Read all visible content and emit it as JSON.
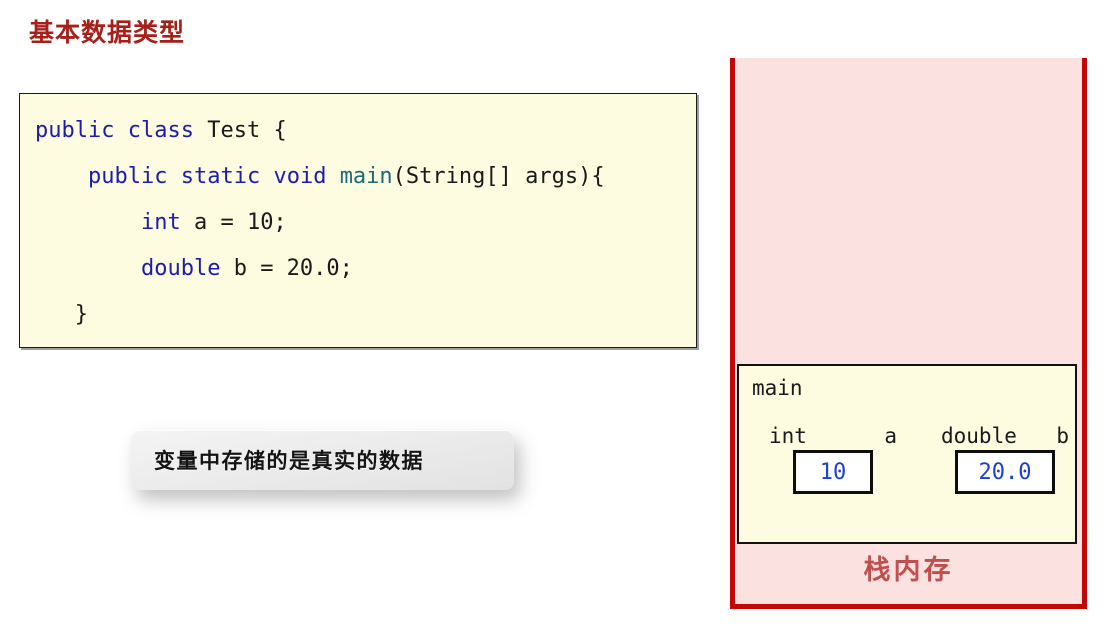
{
  "page": {
    "title": "基本数据类型"
  },
  "code_block": {
    "language": "java",
    "lines": [
      [
        {
          "t": "public",
          "c": "kw"
        },
        {
          "t": " ",
          "c": "plain"
        },
        {
          "t": "class",
          "c": "kw"
        },
        {
          "t": " Test {",
          "c": "plain"
        }
      ],
      [
        {
          "t": "    ",
          "c": "plain"
        },
        {
          "t": "public",
          "c": "kw"
        },
        {
          "t": " ",
          "c": "plain"
        },
        {
          "t": "static",
          "c": "kw"
        },
        {
          "t": " ",
          "c": "plain"
        },
        {
          "t": "void",
          "c": "kw"
        },
        {
          "t": " ",
          "c": "plain"
        },
        {
          "t": "main",
          "c": "fn"
        },
        {
          "t": "(String[] args){",
          "c": "plain"
        }
      ],
      [
        {
          "t": "        ",
          "c": "plain"
        },
        {
          "t": "int",
          "c": "kw"
        },
        {
          "t": " a = 10;",
          "c": "plain"
        }
      ],
      [
        {
          "t": "        ",
          "c": "plain"
        },
        {
          "t": "double",
          "c": "kw"
        },
        {
          "t": " b = 20.0;",
          "c": "plain"
        }
      ],
      [
        {
          "t": "   }",
          "c": "plain"
        }
      ],
      [
        {
          "t": " }",
          "c": "plain"
        }
      ]
    ]
  },
  "callout": {
    "text": "变量中存储的是真实的数据"
  },
  "stack_panel": {
    "label": "栈内存",
    "frame": {
      "name": "main",
      "variables": [
        {
          "type": "int",
          "name": "a",
          "value": "10"
        },
        {
          "type": "double",
          "name": "b",
          "value": "20.0"
        }
      ]
    }
  },
  "colors": {
    "title_red": "#a62019",
    "panel_border_red": "#c00808",
    "panel_fill_pink": "#fce1e1",
    "stack_label_red": "#bf504d",
    "code_bg": "#fdfbe0",
    "keyword_blue": "#1c1cb0",
    "method_teal": "#1d6a78",
    "value_blue": "#1c3fd4"
  }
}
